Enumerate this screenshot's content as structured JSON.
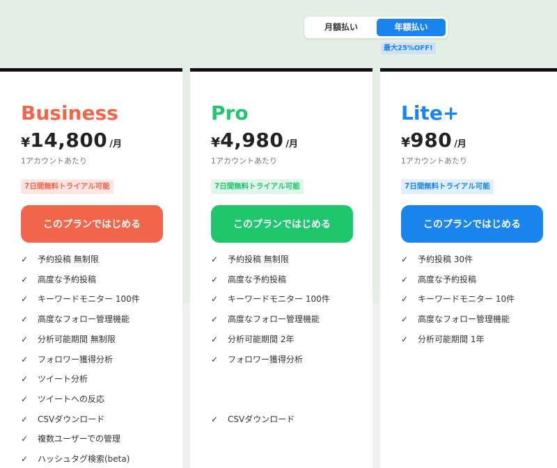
{
  "billing": {
    "monthly_label": "月額払い",
    "yearly_label": "年額払い",
    "selected": "yearly",
    "discount_badge": "最大25%OFF!",
    "selected_color": "#1a84ef"
  },
  "plans": [
    {
      "name": "Business",
      "color": "#f2654a",
      "trial_bg": "#fde6e1",
      "currency": "¥",
      "price": "14,800",
      "unit": "/月",
      "per_account": "1アカウントあたり",
      "trial": "7日間無料トライアル可能",
      "cta": "このプランではじめる",
      "features": [
        "予約投稿 無制限",
        "高度な予約投稿",
        "キーワードモニター 100件",
        "高度なフォロー管理機能",
        "分析可能期間 無制限",
        "フォロワー獲得分析",
        "ツイート分析",
        "ツイートへの反応",
        "CSVダウンロード",
        "複数ユーザーでの管理",
        "ハッシュタグ検索(beta)"
      ]
    },
    {
      "name": "Pro",
      "color": "#1ec66c",
      "trial_bg": "#e0f6ea",
      "currency": "¥",
      "price": "4,980",
      "unit": "/月",
      "per_account": "1アカウントあたり",
      "trial": "7日間無料トライアル可能",
      "cta": "このプランではじめる",
      "features": [
        "予約投稿 無制限",
        "高度な予約投稿",
        "キーワードモニター 100件",
        "高度なフォロー管理機能",
        "分析可能期間 2年",
        "フォロワー獲得分析",
        "CSVダウンロード"
      ],
      "feature_rows": [
        0,
        1,
        2,
        3,
        4,
        5,
        8
      ]
    },
    {
      "name": "Lite+",
      "color": "#1a84ef",
      "trial_bg": "#e1eefb",
      "currency": "¥",
      "price": "980",
      "unit": "/月",
      "per_account": "1アカウントあたり",
      "trial": "7日間無料トライアル可能",
      "cta": "このプランではじめる",
      "features": [
        "予約投稿 30件",
        "高度な予約投稿",
        "キーワードモニター 10件",
        "高度なフォロー管理機能",
        "分析可能期間 1年"
      ]
    }
  ]
}
